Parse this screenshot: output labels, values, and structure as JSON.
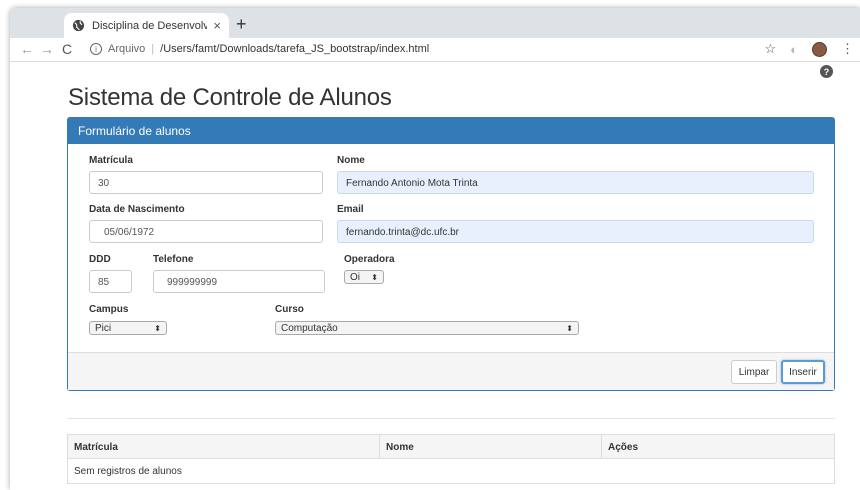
{
  "browser": {
    "tab_title": "Disciplina de Desenvolvimento",
    "url_label": "Arquivo",
    "url": "/Users/famt/Downloads/tarefa_JS_bootstrap/index.html"
  },
  "page": {
    "title": "Sistema de Controle de Alunos"
  },
  "form": {
    "heading": "Formulário de alunos",
    "matricula": {
      "label": "Matrícula",
      "value": "30"
    },
    "nome": {
      "label": "Nome",
      "value": "Fernando Antonio Mota Trinta"
    },
    "nascimento": {
      "label": "Data de Nascimento",
      "value": "05/06/1972"
    },
    "email": {
      "label": "Email",
      "value": "fernando.trinta@dc.ufc.br"
    },
    "ddd": {
      "label": "DDD",
      "value": "85"
    },
    "telefone": {
      "label": "Telefone",
      "value": "999999999"
    },
    "operadora": {
      "label": "Operadora",
      "value": "Oi"
    },
    "campus": {
      "label": "Campus",
      "value": "Pici"
    },
    "curso": {
      "label": "Curso",
      "value": "Computação"
    },
    "clear_label": "Limpar",
    "insert_label": "Inserir"
  },
  "table": {
    "headers": [
      "Matrícula",
      "Nome",
      "Ações"
    ],
    "empty_message": "Sem registros de alunos"
  }
}
